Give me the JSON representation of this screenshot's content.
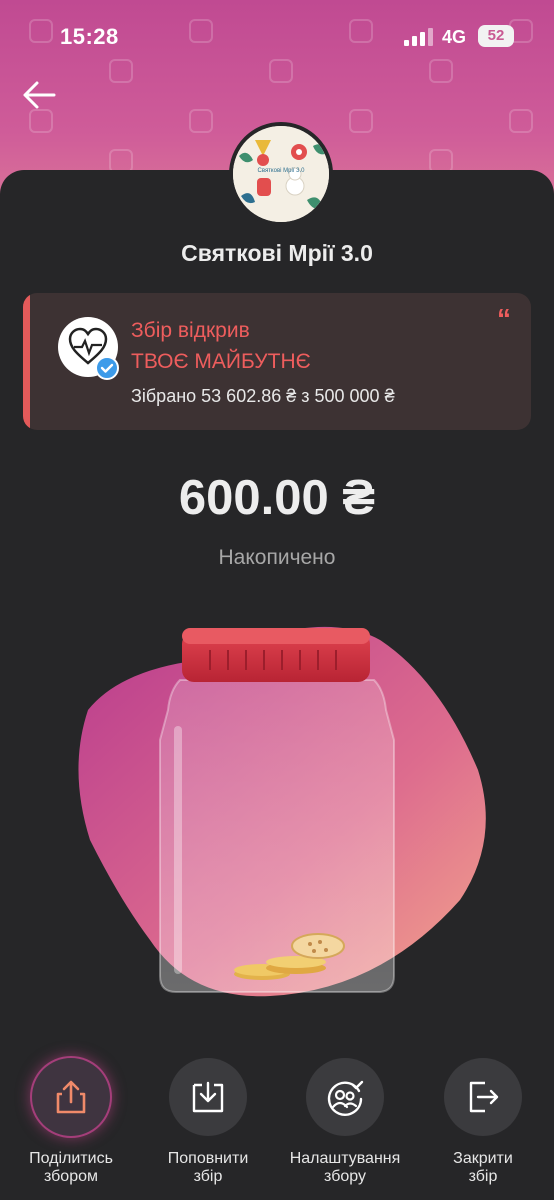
{
  "status_bar": {
    "time": "15:28",
    "network": "4G",
    "battery": "52"
  },
  "header": {
    "title": "Святкові Мрії 3.0",
    "avatar_caption": "Святкові Мрії 3.0"
  },
  "organizer": {
    "label_line1": "Збір відкрив",
    "label_line2": "ТВОЄ МАЙБУТНЄ",
    "progress_text": "Зібрано 53 602.86 ₴ з 500 000 ₴",
    "quote_mark": "“"
  },
  "jar": {
    "amount": "600.00 ₴",
    "amount_label": "Накопичено"
  },
  "actions": [
    {
      "label_line1": "Поділитись",
      "label_line2": "збором",
      "icon": "share-icon"
    },
    {
      "label_line1": "Поповнити",
      "label_line2": "збір",
      "icon": "deposit-icon"
    },
    {
      "label_line1": "Налаштування",
      "label_line2": "збору",
      "icon": "settings-icon"
    },
    {
      "label_line1": "Закрити",
      "label_line2": "збір",
      "icon": "exit-icon"
    }
  ],
  "colors": {
    "accent_red": "#ee5d5d",
    "background_dark": "#262628",
    "header_pink": "#c04a92",
    "jar_lid": "#d63644"
  }
}
